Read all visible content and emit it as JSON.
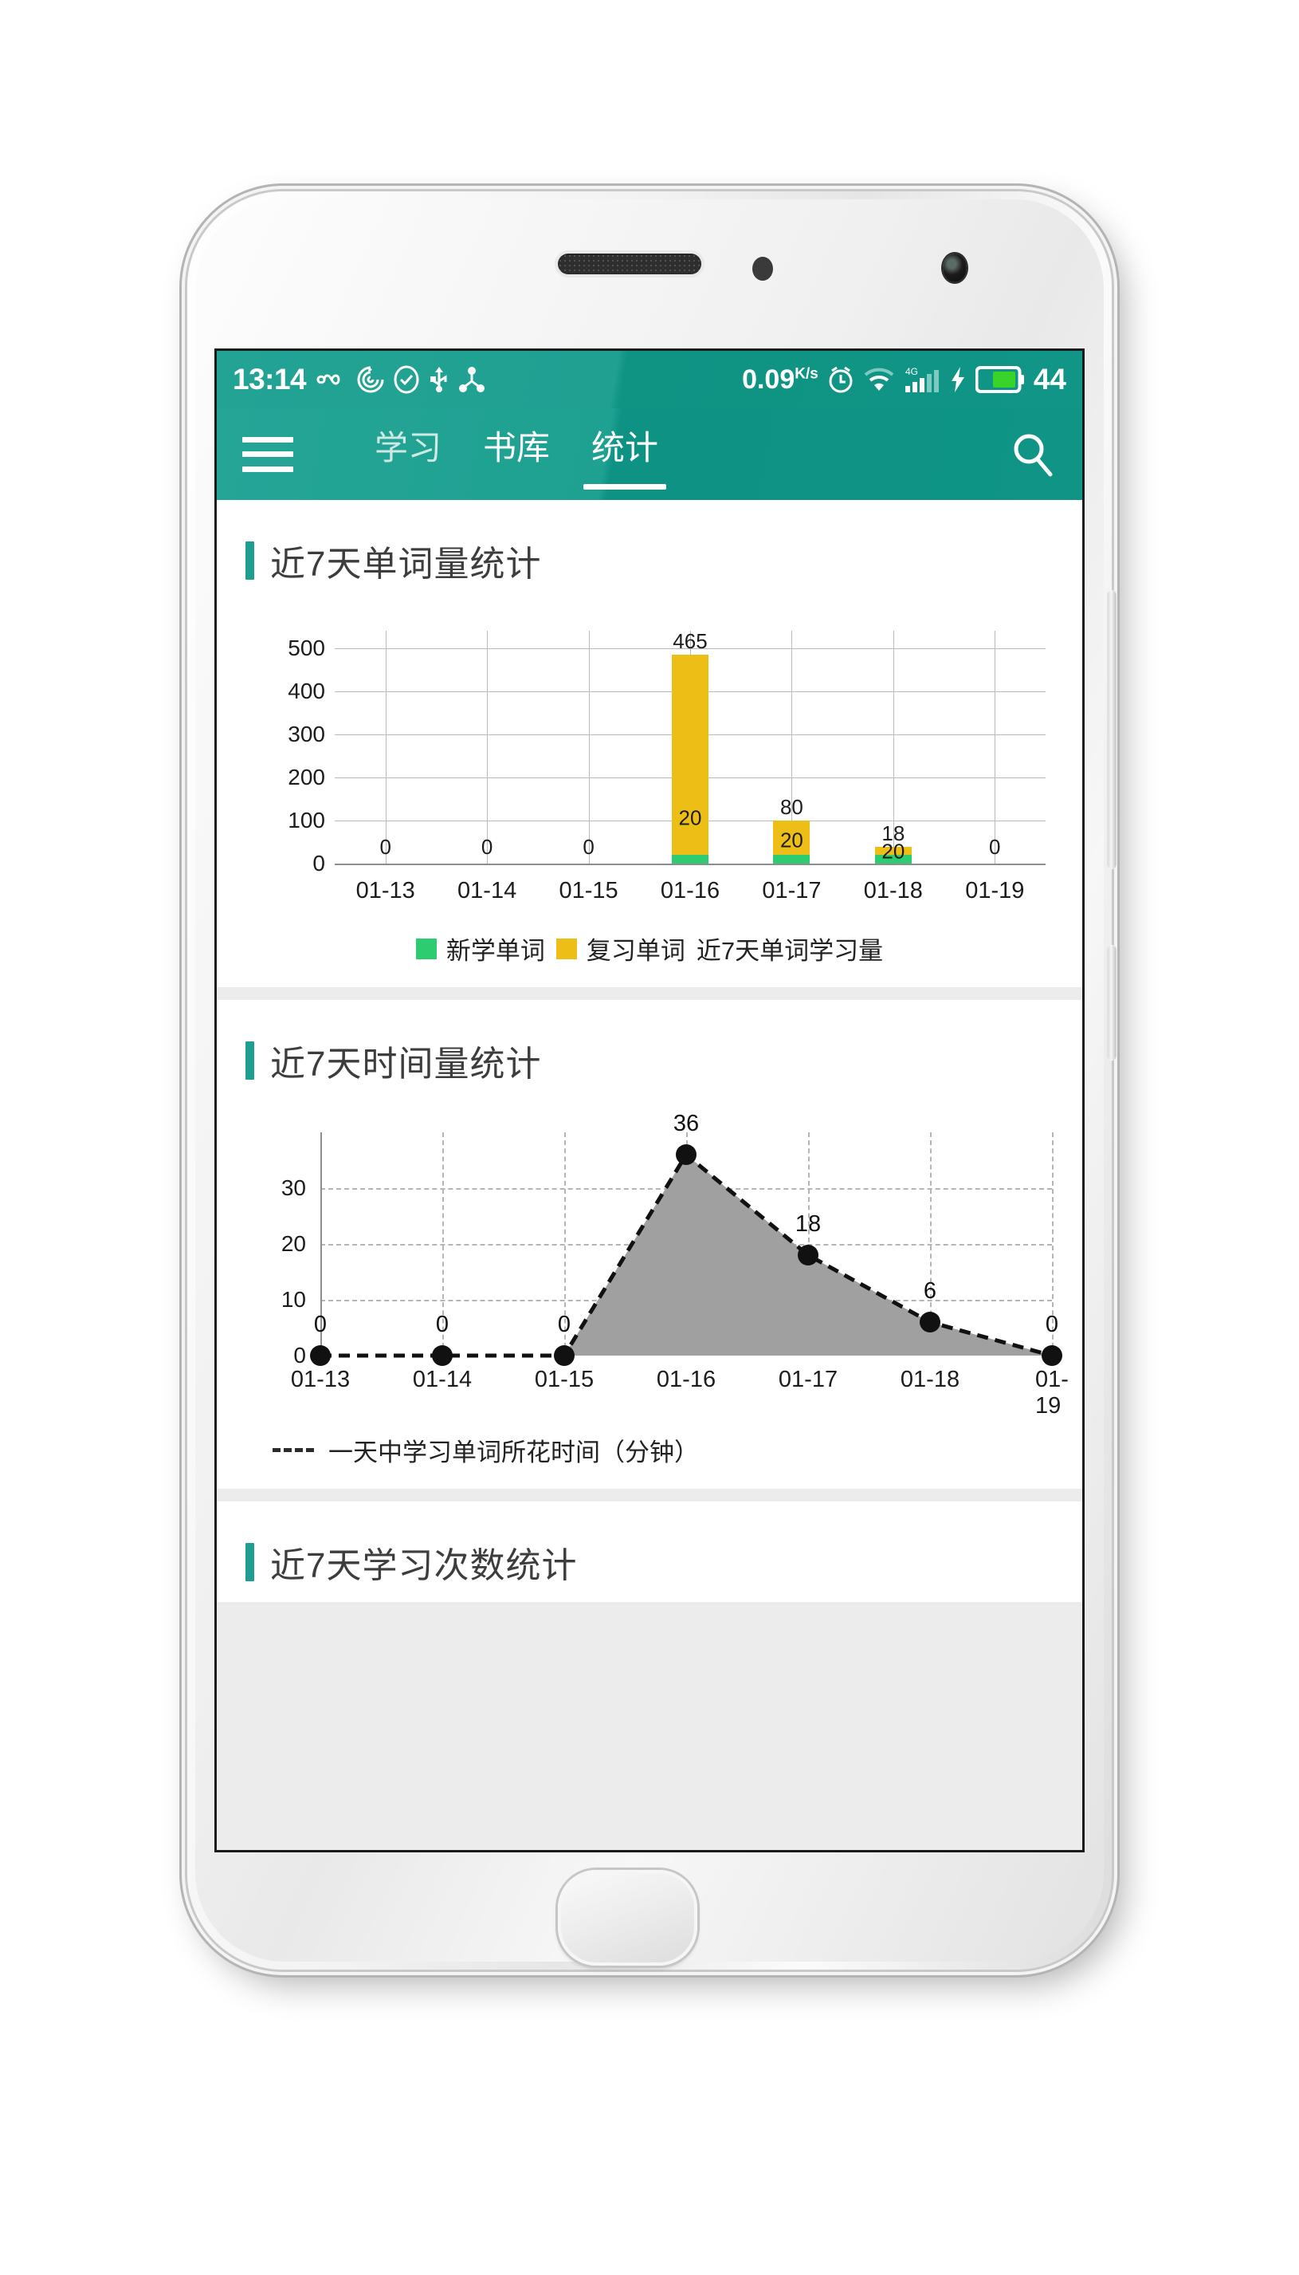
{
  "status_bar": {
    "time": "13:14",
    "icons_left": [
      "infinity-icon",
      "spiral-icon",
      "check-circle-icon",
      "usb-icon",
      "bluetooth-share-icon"
    ],
    "network_speed": "0.09",
    "network_speed_unit_top": "K",
    "network_speed_unit_bottom": "s",
    "icons_right": [
      "alarm-icon",
      "wifi-icon",
      "4g-signal-icon",
      "charging-bolt-icon",
      "battery-icon"
    ],
    "signal_label": "4G",
    "battery_percent": "44"
  },
  "app_bar": {
    "menu_icon": "hamburger-menu-icon",
    "search_icon": "search-icon",
    "tabs": [
      {
        "label": "学习",
        "active": false
      },
      {
        "label": "书库",
        "active": false
      },
      {
        "label": "统计",
        "active": true
      }
    ]
  },
  "sections": [
    {
      "title": "近7天单词量统计"
    },
    {
      "title": "近7天时间量统计"
    },
    {
      "title": "近7天学习次数统计"
    }
  ],
  "colors": {
    "brand_teal": "#1d9e90",
    "status_teal": "#0f9383",
    "new_word_green": "#2ecc71",
    "review_yellow": "#edbf16",
    "area_gray": "#a0a0a0"
  },
  "chart_data": [
    {
      "type": "bar",
      "title": "近7天单词量统计",
      "stacked": true,
      "categories": [
        "01-13",
        "01-14",
        "01-15",
        "01-16",
        "01-17",
        "01-18",
        "01-19"
      ],
      "series": [
        {
          "name": "新学单词",
          "color": "#2ecc71",
          "values": [
            0,
            0,
            0,
            20,
            20,
            20,
            0
          ]
        },
        {
          "name": "复习单词",
          "color": "#edbf16",
          "values": [
            0,
            0,
            0,
            465,
            80,
            18,
            0
          ]
        }
      ],
      "point_labels_top": [
        "0",
        "0",
        "0",
        "465",
        "80",
        "18",
        "0"
      ],
      "point_labels_inner": [
        "",
        "",
        "",
        "20",
        "20",
        "20",
        ""
      ],
      "legend": [
        "新学单词",
        "复习单词",
        "近7天单词学习量"
      ],
      "legend_position": "bottom",
      "ylabel": "",
      "xlabel": "",
      "yticks": [
        0,
        100,
        200,
        300,
        400,
        500
      ],
      "ylim": [
        0,
        540
      ],
      "grid": true
    },
    {
      "type": "area",
      "title": "近7天时间量统计",
      "categories": [
        "01-13",
        "01-14",
        "01-15",
        "01-16",
        "01-17",
        "01-18",
        "01-19"
      ],
      "values": [
        0,
        0,
        0,
        36,
        18,
        6,
        0
      ],
      "point_labels": [
        "0",
        "0",
        "0",
        "36",
        "18",
        "6",
        "0"
      ],
      "legend": [
        "一天中学习单词所花时间（分钟）"
      ],
      "legend_position": "bottom-left",
      "line_style": "dashed",
      "fill_color": "#a0a0a0",
      "ylabel": "",
      "xlabel": "",
      "yticks": [
        0,
        10,
        20,
        30
      ],
      "ylim": [
        0,
        40
      ],
      "grid": true
    }
  ]
}
